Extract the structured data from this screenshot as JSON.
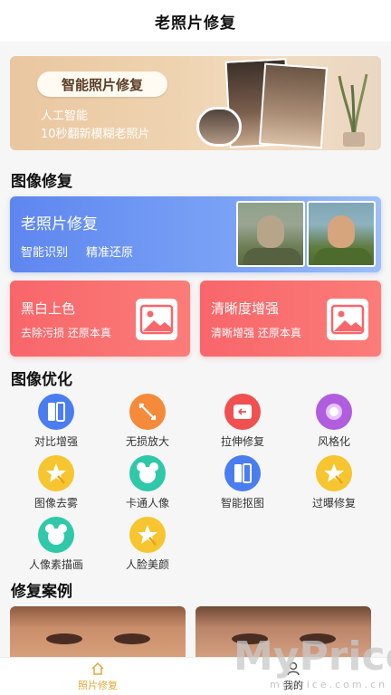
{
  "header": {
    "title": "老照片修复"
  },
  "banner": {
    "pill": "智能照片修复",
    "line1": "人工智能",
    "line2": "10秒翻新模糊老照片"
  },
  "sections": {
    "repair": "图像修复",
    "optimize": "图像优化",
    "cases": "修复案例"
  },
  "restore_card": {
    "title": "老照片修复",
    "sub_a": "智能识别",
    "sub_b": "精准还原"
  },
  "color_card": {
    "title": "黑白上色",
    "sub": "去除污损  还原本真"
  },
  "clarity_card": {
    "title": "清晰度增强",
    "sub": "清晰增强  还原本真"
  },
  "tools": [
    {
      "label": "对比增强",
      "icon": "contrast-icon",
      "color": "#4a7df0"
    },
    {
      "label": "无损放大",
      "icon": "enlarge-icon",
      "color": "#f58a3a"
    },
    {
      "label": "拉伸修复",
      "icon": "stretch-icon",
      "color": "#f0504f"
    },
    {
      "label": "风格化",
      "icon": "style-icon",
      "color": "#b05de0"
    },
    {
      "label": "图像去雾",
      "icon": "magic-wand-icon",
      "color": "#f6c52f"
    },
    {
      "label": "卡通人像",
      "icon": "cartoon-icon",
      "color": "#2fc8a8"
    },
    {
      "label": "智能抠图",
      "icon": "cutout-icon",
      "color": "#4a7df0"
    },
    {
      "label": "过曝修复",
      "icon": "magic-wand-icon",
      "color": "#f6c52f"
    },
    {
      "label": "人像素描画",
      "icon": "cartoon-icon",
      "color": "#2fc8a8"
    },
    {
      "label": "人脸美颜",
      "icon": "magic-wand-icon",
      "color": "#f6c52f"
    }
  ],
  "tabbar": {
    "home": "照片修复",
    "mine": "我的",
    "active_color": "#e3a93a"
  },
  "watermark": {
    "big": "MyPrice",
    "small": "myprice.com.cn"
  }
}
